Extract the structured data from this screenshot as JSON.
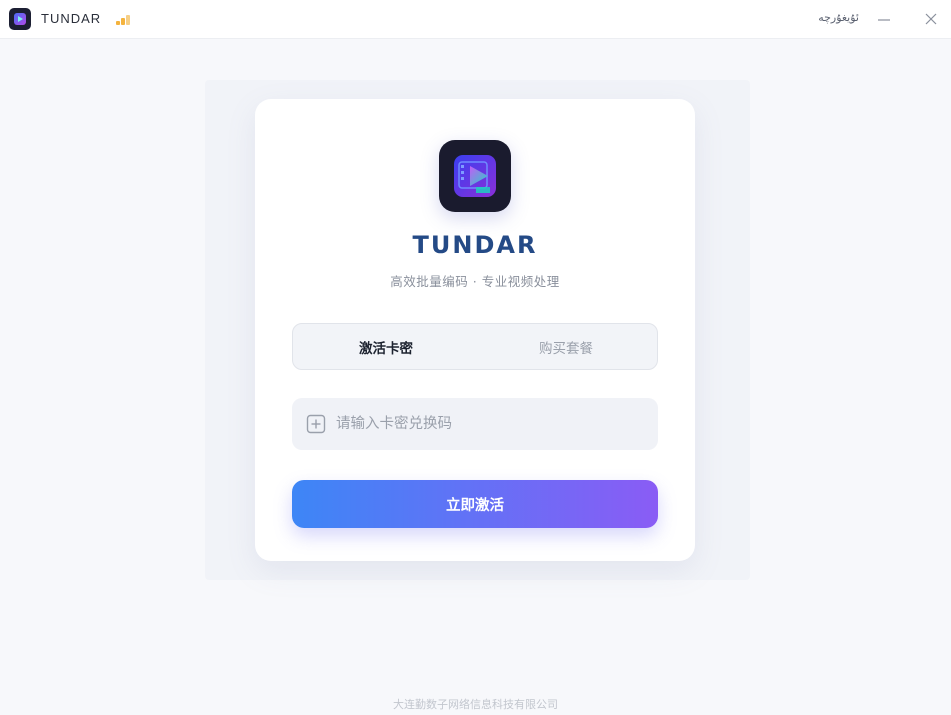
{
  "window": {
    "title": "TUNDAR",
    "language_label": "ئۇيغۇرچە",
    "icons": {
      "app": "app-logo-icon",
      "signal": "signal-bars-icon",
      "minimize": "minimize-icon",
      "close": "close-icon"
    }
  },
  "login": {
    "brand": "TUNDAR",
    "tagline": "高效批量编码 · 专业视频处理",
    "tabs": [
      {
        "label": "激活卡密",
        "active": true
      },
      {
        "label": "购买套餐",
        "active": false
      }
    ],
    "code_input": {
      "placeholder": "请输入卡密兑换码",
      "value": "",
      "icon": "plus-square-icon"
    },
    "activate_button": "立即激活"
  },
  "footer": {
    "company": "大连勤数子网络信息科技有限公司"
  },
  "colors": {
    "brand_text": "#244a86",
    "button_gradient_start": "#3d86f6",
    "button_gradient_end": "#8a5cf5",
    "signal": "#f4b33e"
  }
}
